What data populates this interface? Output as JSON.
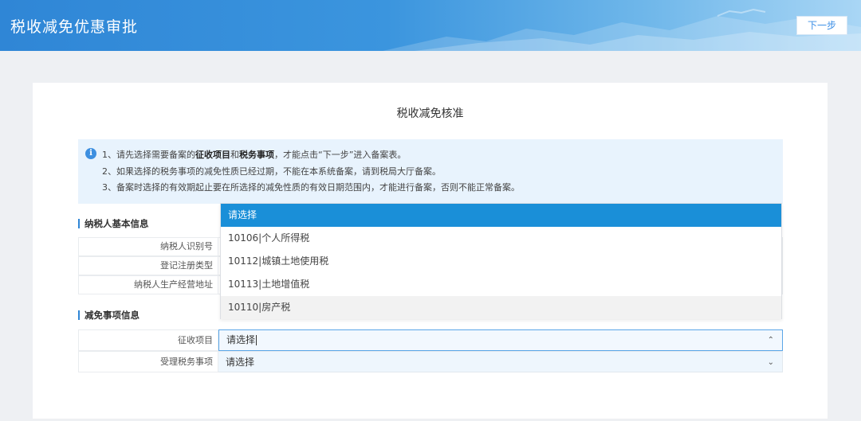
{
  "header": {
    "title": "税收减免优惠审批",
    "next_label": "下一步"
  },
  "card": {
    "title": "税收减免核准",
    "notice": {
      "line1_prefix": "1、请先选择需要备案的",
      "line1_bold1": "征收项目",
      "line1_mid": "和",
      "line1_bold2": "税务事项",
      "line1_suffix": "，才能点击“下一步”进入备案表。",
      "line2": "2、如果选择的税务事项的减免性质已经过期，不能在本系统备案，请到税局大厅备案。",
      "line3": "3、备案时选择的有效期起止要在所选择的减免性质的有效日期范围内，才能进行备案，否则不能正常备案。"
    },
    "taxpayer_section": {
      "title": "纳税人基本信息",
      "rows": [
        {
          "label": "纳税人识别号",
          "value": ""
        },
        {
          "label": "登记注册类型",
          "value": ""
        },
        {
          "label": "纳税人生产经营地址",
          "value": ""
        }
      ]
    },
    "relief_section": {
      "title": "减免事项信息",
      "levy_item": {
        "label": "征收项目",
        "value": "请选择"
      },
      "tax_matter": {
        "label": "受理税务事项",
        "value": "请选择"
      }
    },
    "dropdown_options": [
      "请选择",
      "10106|个人所得税",
      "10112|城镇土地使用税",
      "10113|土地增值税",
      "10110|房产税"
    ]
  },
  "colors": {
    "accent": "#2f86d6",
    "selected_option": "#1a8fd8",
    "notice_bg": "#e8f3fd"
  }
}
